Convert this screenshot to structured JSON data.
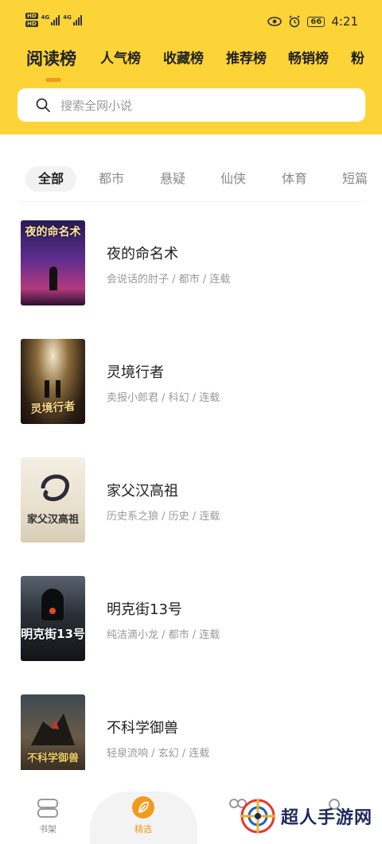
{
  "status": {
    "hd1": "HD",
    "hd2": "HD",
    "net1": "4G",
    "net2": "4G",
    "battery": "66",
    "time": "4:21"
  },
  "tabs": [
    {
      "label": "阅读榜",
      "active": true
    },
    {
      "label": "人气榜"
    },
    {
      "label": "收藏榜"
    },
    {
      "label": "推荐榜"
    },
    {
      "label": "畅销榜"
    },
    {
      "label": "粉"
    }
  ],
  "search": {
    "placeholder": "搜索全网小说"
  },
  "categories": [
    {
      "label": "全部",
      "active": true
    },
    {
      "label": "都市"
    },
    {
      "label": "悬疑"
    },
    {
      "label": "仙侠"
    },
    {
      "label": "体育"
    },
    {
      "label": "短篇"
    }
  ],
  "books": [
    {
      "title": "夜的命名术",
      "meta": "会说话的肘子 / 都市 / 连载",
      "cover_text": "夜的命名术"
    },
    {
      "title": "灵境行者",
      "meta": "卖报小郎君 / 科幻 / 连载",
      "cover_text": "灵境行者"
    },
    {
      "title": "家父汉高祖",
      "meta": "历史系之狼 / 历史 / 连载",
      "cover_text": "家父汉高祖"
    },
    {
      "title": "明克街13号",
      "meta": "纯洁滴小龙 / 都市 / 连载",
      "cover_text": "明克街13号"
    },
    {
      "title": "不科学御兽",
      "meta": "轻泉流响 / 玄幻 / 连载",
      "cover_text": "不科学御兽"
    }
  ],
  "bottom_nav": [
    {
      "label": "书架",
      "icon": "bookshelf-icon"
    },
    {
      "label": "精选",
      "icon": "leaf-icon",
      "active": true
    },
    {
      "label": "",
      "icon": "category-icon"
    },
    {
      "label": "",
      "icon": "profile-icon"
    }
  ],
  "watermark": {
    "text": "超人手游网"
  },
  "colors": {
    "accent": "#fcd437",
    "highlight": "#f39a1e"
  }
}
